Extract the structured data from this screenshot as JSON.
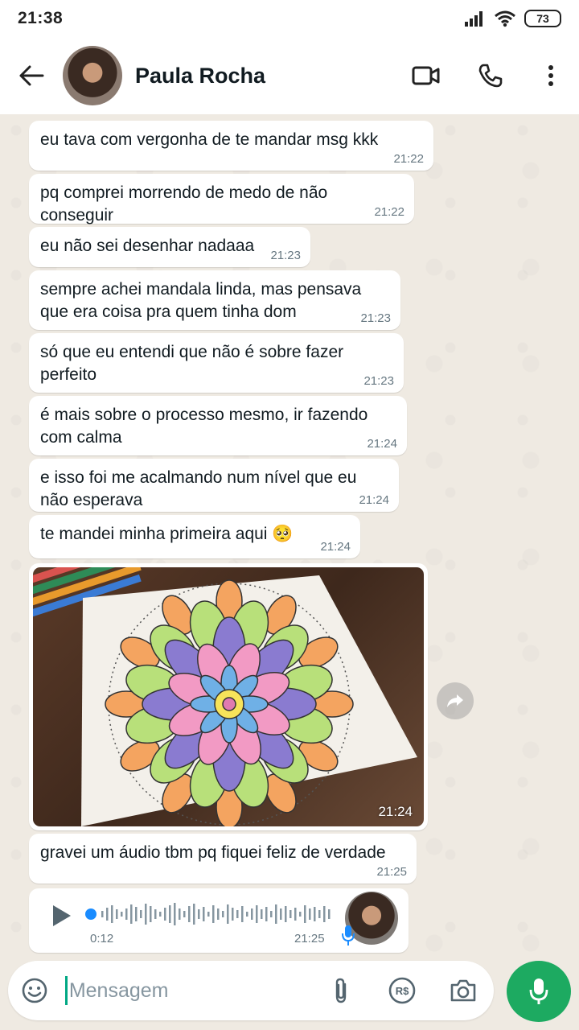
{
  "status": {
    "time": "21:38",
    "battery": "73"
  },
  "header": {
    "contact_name": "Paula Rocha"
  },
  "messages": [
    {
      "text": "eu tava com vergonha de te mandar msg kkk",
      "time": "21:22"
    },
    {
      "text": "pq comprei morrendo de medo de não conseguir",
      "time": "21:22"
    },
    {
      "text": "eu não sei desenhar nadaaa",
      "time": "21:23"
    },
    {
      "text": "sempre achei mandala linda, mas pensava\nque era coisa pra quem tinha dom",
      "time": "21:23"
    },
    {
      "text": "só que eu entendi que não é sobre fazer\nperfeito",
      "time": "21:23"
    },
    {
      "text": "é mais sobre o processo mesmo, ir fazendo\ncom calma",
      "time": "21:24"
    },
    {
      "text": "e isso foi me acalmando num nível que eu\nnão esperava",
      "time": "21:24"
    },
    {
      "text": "te mandei minha primeira aqui 🥺",
      "time": "21:24"
    },
    {
      "text": "gravei um áudio tbm pq fiquei feliz de verdade",
      "time": "21:25"
    }
  ],
  "image_message": {
    "time": "21:24",
    "icon": "forward-icon"
  },
  "audio_message": {
    "duration": "0:12",
    "time": "21:25"
  },
  "input": {
    "placeholder": "Mensagem"
  },
  "colors": {
    "accent": "#1daa61",
    "chat_bg": "#efeae2",
    "bubble": "#ffffff",
    "caret": "#00a884",
    "waveform_progress": "#1a8cff"
  }
}
